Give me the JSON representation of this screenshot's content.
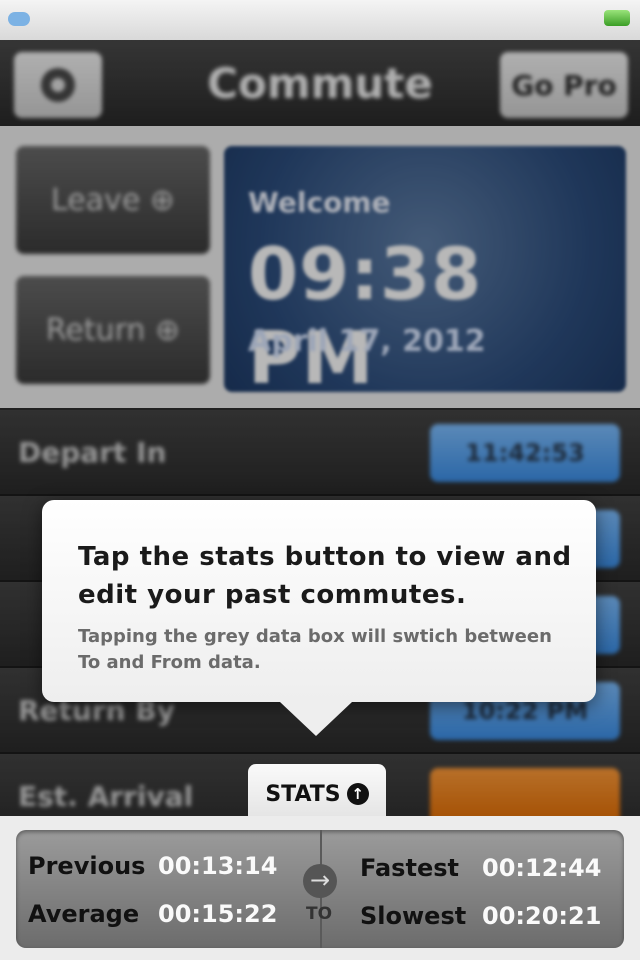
{
  "header": {
    "title": "Commute",
    "go_pro_label": "Go Pro"
  },
  "actions": {
    "leave_label": "Leave ⊕",
    "return_label": "Return ⊕"
  },
  "clock": {
    "welcome": "Welcome",
    "time": "09:38 PM",
    "date": "April 17, 2012"
  },
  "rows": [
    {
      "label": "Depart In",
      "value": "11:42:53",
      "color": "#4b9cf0"
    },
    {
      "label": "",
      "value": "",
      "color": "#4b9cf0"
    },
    {
      "label": "",
      "value": "",
      "color": "#4b9cf0"
    },
    {
      "label": "Return By",
      "value": "10:22 PM",
      "color": "#4b9cf0"
    },
    {
      "label": "Est. Arrival",
      "value": "",
      "color": "#f08a1a"
    }
  ],
  "tooltip": {
    "title": "Tap the stats button to view and edit your past commutes.",
    "body": "Tapping the grey data box will swtich between To and From data."
  },
  "stats_tab": {
    "label": "STATS"
  },
  "stats": {
    "previous_label": "Previous",
    "previous_value": "00:13:14",
    "average_label": "Average",
    "average_value": "00:15:22",
    "fastest_label": "Fastest",
    "fastest_value": "00:12:44",
    "slowest_label": "Slowest",
    "slowest_value": "00:20:21",
    "to_label": "TO"
  }
}
